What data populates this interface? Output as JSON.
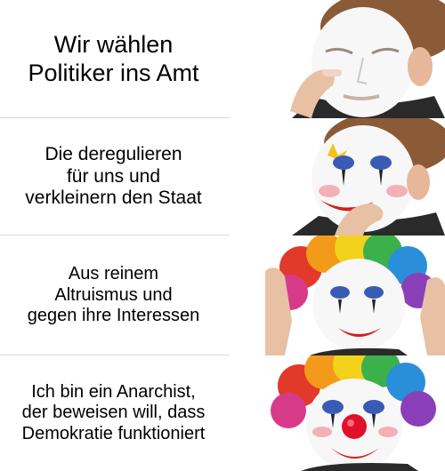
{
  "panels": [
    {
      "caption": "Wir wählen\nPolitiker ins Amt",
      "stage": "white-base-makeup"
    },
    {
      "caption": "Die deregulieren\nfür uns und\nverkleinern den Staat",
      "stage": "eye-and-lip-makeup"
    },
    {
      "caption": "Aus reinem\nAltruismus und\ngegen ihre Interessen",
      "stage": "rainbow-wig"
    },
    {
      "caption": "Ich bin ein Anarchist,\nder beweisen will, dass\nDemokratie funktioniert",
      "stage": "full-clown-red-nose"
    }
  ],
  "colors": {
    "background": "#ffffff",
    "caption_text": "#000000",
    "face_paint": "#f7f7f7",
    "lipstick": "#d41f1f",
    "eye_blue": "#3a5bb5",
    "nose_red": "#e0102a"
  }
}
